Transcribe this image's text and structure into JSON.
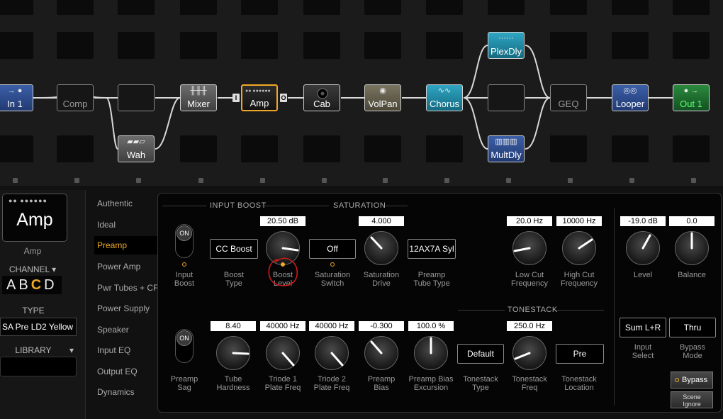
{
  "grid": {
    "blocks": [
      {
        "id": "in1",
        "label": "In 1",
        "glyph": "→ ●",
        "style": "blue"
      },
      {
        "id": "comp",
        "label": "Comp",
        "glyph": "",
        "style": "empty"
      },
      {
        "id": "empty-row1",
        "label": "",
        "glyph": "",
        "style": "empty"
      },
      {
        "id": "wah",
        "label": "Wah",
        "glyph": "",
        "style": "gray"
      },
      {
        "id": "mixer",
        "label": "Mixer",
        "glyph": "╫╫╫",
        "style": "gray"
      },
      {
        "id": "amp",
        "label": "Amp",
        "glyph": "●● ●●●●●●",
        "style": "amp"
      },
      {
        "id": "cab",
        "label": "Cab",
        "glyph": "",
        "style": "cab"
      },
      {
        "id": "volpan",
        "label": "VolPan",
        "glyph": "◉",
        "style": "olive"
      },
      {
        "id": "chorus",
        "label": "Chorus",
        "glyph": "∿∿",
        "style": "teal"
      },
      {
        "id": "plexdly",
        "label": "PlexDly",
        "glyph": "⋯⋯",
        "style": "teal"
      },
      {
        "id": "empty-row1b",
        "label": "",
        "glyph": "",
        "style": "empty"
      },
      {
        "id": "multdly",
        "label": "MultDly",
        "glyph": "▥▥▥",
        "style": "blue"
      },
      {
        "id": "geq",
        "label": "GEQ",
        "glyph": "",
        "style": "empty"
      },
      {
        "id": "looper",
        "label": "Looper",
        "glyph": "◎◎",
        "style": "blue"
      },
      {
        "id": "out1",
        "label": "Out 1",
        "glyph": "● →",
        "style": "green"
      }
    ],
    "ports": {
      "in": "I",
      "out": "O"
    }
  },
  "left": {
    "amp_icon_dots": "●●  ●●●●●●",
    "amp_icon_label": "Amp",
    "amp_caption": "Amp",
    "channel_label": "CHANNEL ▾",
    "channels": [
      "A",
      "B",
      "C",
      "D"
    ],
    "selected_channel": "C",
    "type_label": "TYPE",
    "type_value": "SA Pre LD2 Yellow",
    "library_label": "LIBRARY",
    "library_arrow": "▾"
  },
  "nav": {
    "items": [
      "Authentic",
      "Ideal",
      "Preamp",
      "Power Amp",
      "Pwr Tubes + CF",
      "Power Supply",
      "Speaker",
      "Input EQ",
      "Output EQ",
      "Dynamics"
    ],
    "active": "Preamp"
  },
  "panel": {
    "sections": {
      "input_boost": "INPUT BOOST",
      "saturation": "SATURATION",
      "tonestack": "TONESTACK"
    },
    "row1": {
      "input_boost_toggle": {
        "state": "ON",
        "label1": "Input",
        "label2": "Boost"
      },
      "boost_type": {
        "value": "CC Boost",
        "label1": "Boost",
        "label2": "Type"
      },
      "boost_level": {
        "value": "20.50 dB",
        "label1": "Boost",
        "label2": "Level"
      },
      "saturation_switch": {
        "value": "Off",
        "label1": "Saturation",
        "label2": "Switch"
      },
      "saturation_drive": {
        "value": "4.000",
        "label1": "Saturation",
        "label2": "Drive"
      },
      "preamp_tube_type": {
        "value": "12AX7A Syl",
        "label1": "Preamp",
        "label2": "Tube Type"
      },
      "low_cut": {
        "value": "20.0 Hz",
        "label1": "Low Cut",
        "label2": "Frequency"
      },
      "high_cut": {
        "value": "10000 Hz",
        "label1": "High Cut",
        "label2": "Frequency"
      },
      "level": {
        "value": "-19.0 dB",
        "label1": "Level",
        "label2": ""
      },
      "balance": {
        "value": "0.0",
        "label1": "Balance",
        "label2": ""
      }
    },
    "row2": {
      "preamp_sag": {
        "state": "ON",
        "label1": "Preamp",
        "label2": "Sag"
      },
      "tube_hardness": {
        "value": "8.40",
        "label1": "Tube",
        "label2": "Hardness"
      },
      "triode1": {
        "value": "40000 Hz",
        "label1": "Triode 1",
        "label2": "Plate Freq"
      },
      "triode2": {
        "value": "40000 Hz",
        "label1": "Triode 2",
        "label2": "Plate Freq"
      },
      "preamp_bias": {
        "value": "-0.300",
        "label1": "Preamp",
        "label2": "Bias"
      },
      "bias_excursion": {
        "value": "100.0 %",
        "label1": "Preamp Bias",
        "label2": "Excursion"
      },
      "tonestack_type": {
        "value": "Default",
        "label1": "Tonestack",
        "label2": "Type"
      },
      "tonestack_freq": {
        "value": "250.0 Hz",
        "label1": "Tonestack",
        "label2": "Freq"
      },
      "tonestack_location": {
        "value": "Pre",
        "label1": "Tonestack",
        "label2": "Location"
      },
      "input_select": {
        "value": "Sum L+R",
        "label1": "Input",
        "label2": "Select"
      },
      "bypass_mode": {
        "value": "Thru",
        "label1": "Bypass",
        "label2": "Mode"
      }
    },
    "bypass_button": "Bypass",
    "scene_ignore": {
      "line1": "Scene",
      "line2": "Ignore"
    }
  },
  "colors": {
    "accent": "#f0a826",
    "annotation": "#d01a1a"
  }
}
